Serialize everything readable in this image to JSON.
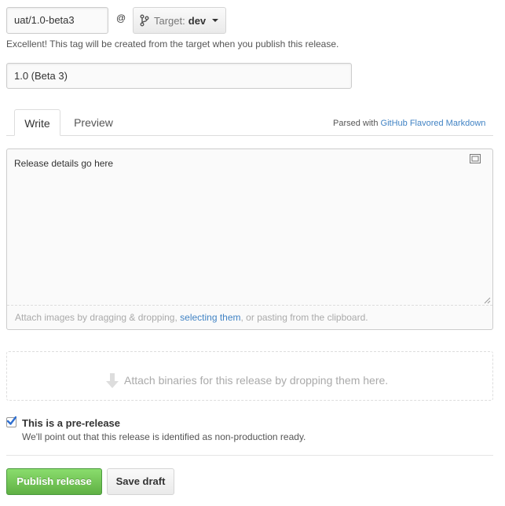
{
  "tag": {
    "value": "uat/1.0-beta3",
    "at_symbol": "@",
    "target_prefix": "Target:",
    "target_value": "dev",
    "note": "Excellent! This tag will be created from the target when you publish this release."
  },
  "release_title": {
    "value": "1.0 (Beta 3)"
  },
  "tabs": [
    {
      "label": "Write"
    },
    {
      "label": "Preview"
    }
  ],
  "parsed_note": {
    "prefix": "Parsed with ",
    "link": "GitHub Flavored Markdown"
  },
  "editor": {
    "text": "Release details go here"
  },
  "attach": {
    "before": "Attach images by dragging & dropping, ",
    "link": "selecting them",
    "after": ", or pasting from the clipboard."
  },
  "binaries": {
    "text": "Attach binaries for this release by dropping them here."
  },
  "prerelease": {
    "checked": true,
    "label": "This is a pre-release",
    "note": "We'll point out that this release is identified as non-production ready."
  },
  "buttons": {
    "publish": "Publish release",
    "draft": "Save draft"
  },
  "colors": {
    "link": "#4183c4",
    "publish_green": "#60b044",
    "checkbox_blue": "#2f6fd0"
  },
  "icons": {
    "branch": "git-branch-icon",
    "fullscreen": "fullscreen-icon",
    "arrow": "down-arrow-icon",
    "checkbox": "checkmark-icon"
  }
}
